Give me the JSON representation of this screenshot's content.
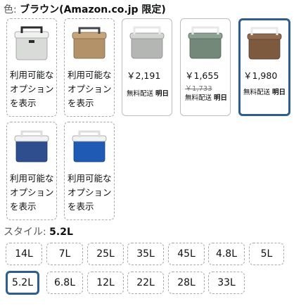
{
  "color": {
    "label": "色: ",
    "value": "ブラウン(Amazon.co.jp 限定)"
  },
  "swatches": [
    {
      "text": "利用可能なオプションを表示",
      "body": "#d8dbd8",
      "lid": "#f0f0f0",
      "handle": "#2b2b2b"
    },
    {
      "text": "利用可能なオプションを表示",
      "body": "#b3926a",
      "lid": "#c8a47a",
      "handle": "#444444"
    },
    {
      "price": "￥2,191",
      "shipping": "無料配送 ",
      "date": "明日",
      "body": "#b4b6b3",
      "lid": "#d3d5d2",
      "handle": "#e8e8e8"
    },
    {
      "price": "￥1,655",
      "old_price": "￥1,733",
      "shipping": "無料配送 ",
      "date": "明日",
      "body": "#738878",
      "lid": "#8ea293",
      "handle": "#e8e8e8"
    },
    {
      "price": "￥1,980",
      "shipping": "無料配送 ",
      "date": "明日",
      "body": "#7d5a3e",
      "lid": "#8f6a4d",
      "handle": "#e8e8e8"
    },
    {
      "text": "利用可能なオプションを表示",
      "body": "#2e4e8e",
      "lid": "#f2f2f2",
      "handle": "#dddddd"
    },
    {
      "text": "利用可能なオプションを表示",
      "body": "#1f5ab4",
      "lid": "#f2f2f2",
      "handle": "#dddddd"
    }
  ],
  "style": {
    "label": "スタイル: ",
    "value": "5.2L"
  },
  "sizes": [
    "14L",
    "7L",
    "25L",
    "35L",
    "45L",
    "4.8L",
    "5L",
    "5.2L",
    "6.8L",
    "12L",
    "22L",
    "28L",
    "33L"
  ],
  "accent_color": "#2d5e8e"
}
